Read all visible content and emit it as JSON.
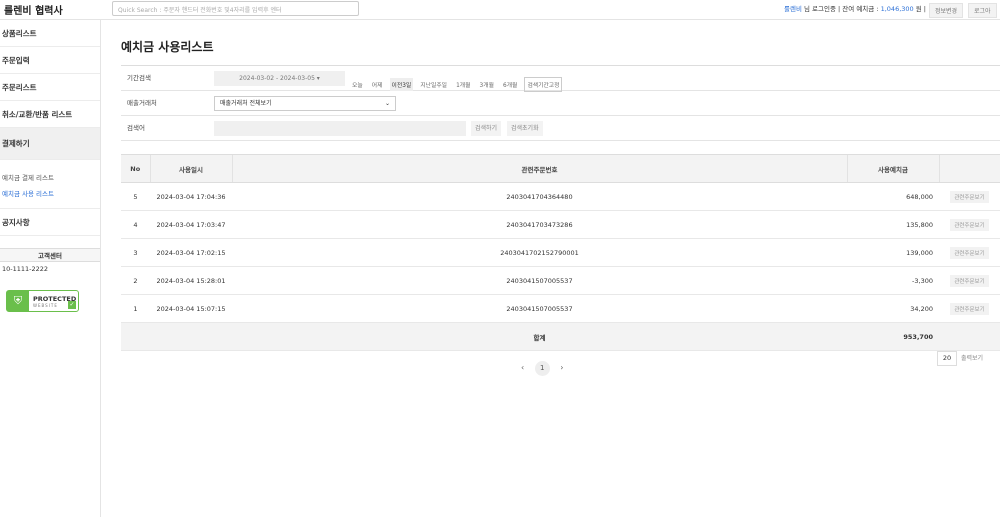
{
  "header": {
    "brand": "룰렌비 협력사",
    "search_placeholder": "Quick Search : 주문자 핸드터 전화번호 및4자리를 입력후 엔터",
    "user_prefix": "룰렌비",
    "user_mid": " 님 로그인중 | 잔여 예치금 : ",
    "balance": "1,046,300",
    "unit": " 원 |",
    "info_btn": "정보변경",
    "logout_btn": "로그아"
  },
  "sidebar": {
    "items": [
      "상품리스트",
      "주문입력",
      "주문리스트",
      "취소/교환/반품 리스트",
      "결제하기"
    ],
    "sub": [
      "예치금 결제 리스트",
      "예치금 사용 리스트"
    ],
    "notice": "공지사항",
    "cs_title": "고객센터",
    "cs_phone": "10-1111-2222",
    "badge_t1": "PROTECTED",
    "badge_t2": "WEBSITE"
  },
  "page": {
    "title": "예치금 사용리스트"
  },
  "filter": {
    "period_label": "기간검색",
    "date_range": "2024-03-02 - 2024-03-05 ▾",
    "chips": [
      "오늘",
      "어제",
      "이전3일",
      "지난일주일",
      "1개월",
      "3개월",
      "6개월",
      "검색기간고정"
    ],
    "seller_label": "매출거래처",
    "seller_value": "매출거래처 전체보기",
    "keyword_label": "검색어",
    "search_btn": "검색하기",
    "reset_btn": "검색초기화"
  },
  "table": {
    "headers": [
      "No",
      "사용일시",
      "관련주문번호",
      "사용예치금",
      ""
    ],
    "rows": [
      {
        "no": "5",
        "date": "2024-03-04 17:04:36",
        "order": "2403041704364480",
        "amount": "648,000",
        "btn": "관련주문보기"
      },
      {
        "no": "4",
        "date": "2024-03-04 17:03:47",
        "order": "2403041703473286",
        "amount": "135,800",
        "btn": "관련주문보기"
      },
      {
        "no": "3",
        "date": "2024-03-04 17:02:15",
        "order": "240304170215279000​1",
        "amount": "139,000",
        "btn": "관련주문보기"
      },
      {
        "no": "2",
        "date": "2024-03-04 15:28:01",
        "order": "2403041507005537",
        "amount": "-3,300",
        "btn": "관련주문보기"
      },
      {
        "no": "1",
        "date": "2024-03-04 15:07:15",
        "order": "2403041507005537",
        "amount": "34,200",
        "btn": "관련주문보기"
      }
    ],
    "sum_label": "합계",
    "sum_value": "953,700"
  },
  "pagination": {
    "prev": "‹",
    "current": "1",
    "next": "›",
    "per_page": "20",
    "view_btn": "출력보기"
  }
}
